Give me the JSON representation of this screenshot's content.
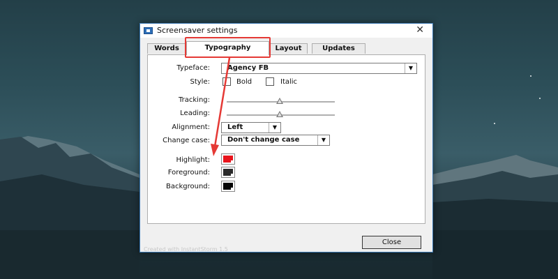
{
  "window": {
    "title": "Screensaver settings",
    "close_glyph": "✕",
    "footer": "Created with InstantStorm 1.5"
  },
  "tabs": [
    {
      "label": "Words"
    },
    {
      "label": "Typography"
    },
    {
      "label": "Layout"
    },
    {
      "label": "Updates"
    }
  ],
  "typography": {
    "typeface_label": "Typeface:",
    "typeface_value": "Agency FB",
    "style_label": "Style:",
    "bold_label": "Bold",
    "italic_label": "Italic",
    "tracking_label": "Tracking:",
    "leading_label": "Leading:",
    "alignment_label": "Alignment:",
    "alignment_value": "Left",
    "change_case_label": "Change case:",
    "change_case_value": "Don't change case",
    "highlight_label": "Highlight:",
    "foreground_label": "Foreground:",
    "background_label": "Background:"
  },
  "colors": {
    "highlight": "#e8141c",
    "foreground": "#2b2b2b",
    "background": "#050505",
    "annotation": "#e53935"
  },
  "buttons": {
    "close_label": "Close"
  },
  "icons": {
    "dropdown_glyph": "▼"
  }
}
